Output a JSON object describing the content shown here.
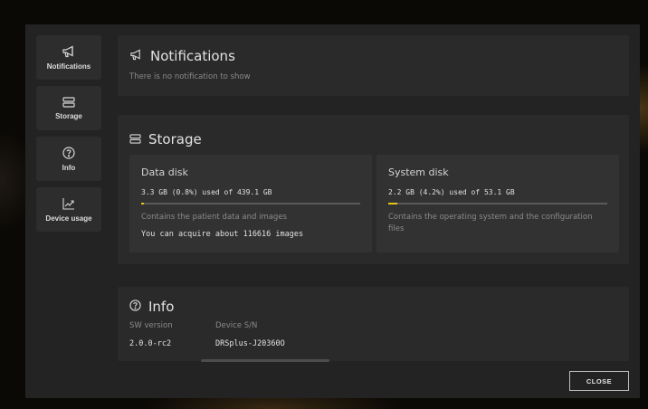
{
  "sidebar": {
    "items": [
      {
        "label": "Notifications",
        "icon": "megaphone-icon"
      },
      {
        "label": "Storage",
        "icon": "storage-icon"
      },
      {
        "label": "Info",
        "icon": "question-icon"
      },
      {
        "label": "Device usage",
        "icon": "trend-chart-icon"
      }
    ]
  },
  "notifications": {
    "title": "Notifications",
    "message": "There is no notification to show"
  },
  "storage": {
    "title": "Storage",
    "data_disk": {
      "title": "Data disk",
      "used": "3.3 GB (0.8%) used of 439.1 GB",
      "percent": 0.8,
      "description": "Contains the patient data and images",
      "extra": "You can acquire about 116616 images"
    },
    "system_disk": {
      "title": "System disk",
      "used": "2.2 GB (4.2%) used of 53.1 GB",
      "percent": 4.2,
      "description": "Contains the operating system and the configuration files"
    }
  },
  "info": {
    "title": "Info",
    "sw_version_label": "SW version",
    "sw_version": "2.0.0-rc2",
    "serial_label": "Device S/N",
    "serial": "DRSplus-J20360O"
  },
  "footer": {
    "close_label": "CLOSE"
  },
  "colors": {
    "accent": "#e3c21a",
    "dialog_bg": "#232323",
    "card_bg": "#2a2a2a"
  }
}
